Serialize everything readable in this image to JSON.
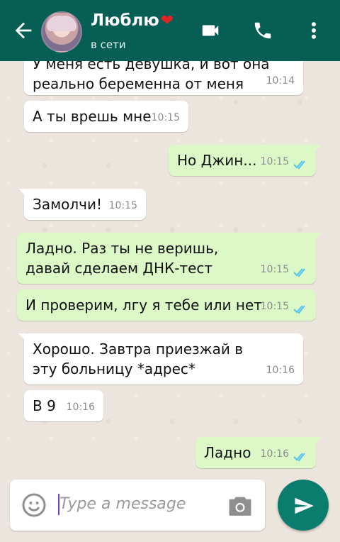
{
  "header": {
    "contact_name": "Люблю",
    "status": "в сети",
    "heart": "❤"
  },
  "messages": [
    {
      "dir": "in",
      "text": "У меня есть девушка, и вот она реально беременна от меня",
      "time": "10:14"
    },
    {
      "dir": "in",
      "text": "А ты врешь мне",
      "time": "10:15"
    },
    {
      "dir": "out",
      "text": "Но Джин...",
      "time": "10:15"
    },
    {
      "dir": "in",
      "text": "Замолчи!",
      "time": "10:15"
    },
    {
      "dir": "out",
      "text": "Ладно. Раз ты не веришь, давай сделаем ДНК-тест",
      "time": "10:15"
    },
    {
      "dir": "out",
      "text": "И проверим, лгу я тебе или нет",
      "time": "10:15"
    },
    {
      "dir": "in",
      "text": "Хорошо. Завтра приезжай в эту больницу *адрес*",
      "time": "10:16"
    },
    {
      "dir": "in",
      "text": "В 9",
      "time": "10:16"
    },
    {
      "dir": "out",
      "text": "Ладно",
      "time": "10:16"
    }
  ],
  "composer": {
    "placeholder": "Type a message"
  },
  "colors": {
    "header": "#075e54",
    "outgoing_bubble": "#dcf8c6",
    "incoming_bubble": "#ffffff",
    "send_button": "#0b7d6e",
    "read_check": "#4fc3f7"
  },
  "icons": {
    "back": "arrow-left-icon",
    "video": "video-camera-icon",
    "call": "phone-icon",
    "more": "more-vert-icon",
    "emoji": "emoji-icon",
    "camera": "camera-icon",
    "send": "send-icon"
  }
}
